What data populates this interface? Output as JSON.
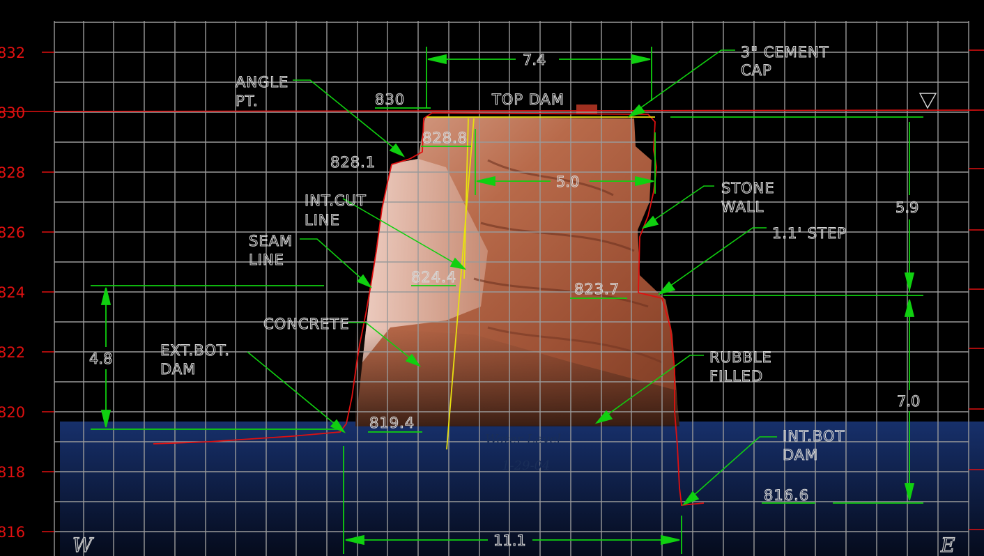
{
  "elevation_axis": {
    "ticks": [
      "832",
      "830",
      "828",
      "826",
      "824",
      "822",
      "820",
      "818",
      "816"
    ],
    "color": "#e01010"
  },
  "labels": {
    "angle_pt_1": "ANGLE",
    "angle_pt_2": "PT.",
    "top_dam": "TOP DAM",
    "cement_cap_1": "3\" CEMENT",
    "cement_cap_2": "CAP",
    "stone_wall_1": "STONE",
    "stone_wall_2": "WALL",
    "step": "1.1' STEP",
    "int_cut_1": "INT.CUT",
    "int_cut_2": "LINE",
    "seam_1": "SEAM",
    "seam_2": "LINE",
    "concrete": "CONCRETE",
    "ext_bot_1": "EXT.BOT.",
    "ext_bot_2": "DAM",
    "rubble_1": "RUBBLE",
    "rubble_2": "FILLED",
    "int_bot_1": "INT.BOT",
    "int_bot_2": "DAM",
    "water_level_1": "Water Level",
    "water_level_2": "1-29-04",
    "west": "W",
    "east": "E"
  },
  "elevations": {
    "e830": "830",
    "e828_8": "828.8",
    "e828_1": "828.1",
    "e824_4": "824.4",
    "e823_7": "823.7",
    "e819_4": "819.4",
    "e816_6": "816.6"
  },
  "dimensions": {
    "top_width": "7.4",
    "inner_width": "5.0",
    "height_right_upper": "5.9",
    "height_right_lower": "7.0",
    "height_left": "4.8",
    "base_width": "11.1"
  },
  "colors": {
    "grid": "#9a9a9a",
    "leader": "#10d010",
    "profile": "#e01010",
    "cut_line": "#e8e010",
    "water": "#0f2350",
    "rock": "#b5674a"
  }
}
